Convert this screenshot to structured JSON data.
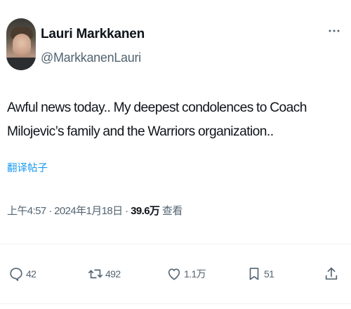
{
  "author": {
    "display_name": "Lauri Markkanen",
    "handle": "@MarkkanenLauri"
  },
  "tweet": {
    "text": "Awful news today.. My deepest condolences to Coach Milojevic’s family and the Warriors organization..",
    "translate_label": "翻译帖子"
  },
  "meta": {
    "time": "上午4:57",
    "separator": "·",
    "date": "2024年1月18日",
    "views_count": "39.6万",
    "views_label": "查看"
  },
  "actions": {
    "reply_count": "42",
    "retweet_count": "492",
    "like_count": "1.1万",
    "bookmark_count": "51"
  },
  "icons": {
    "more": "more-horizontal-icon",
    "reply": "reply-bubble-icon",
    "retweet": "retweet-arrows-icon",
    "like": "heart-icon",
    "bookmark": "bookmark-icon",
    "share": "share-upload-icon"
  },
  "colors": {
    "text_primary": "#0f1419",
    "text_secondary": "#536471",
    "link": "#1d9bf0",
    "divider": "#eff3f4"
  }
}
